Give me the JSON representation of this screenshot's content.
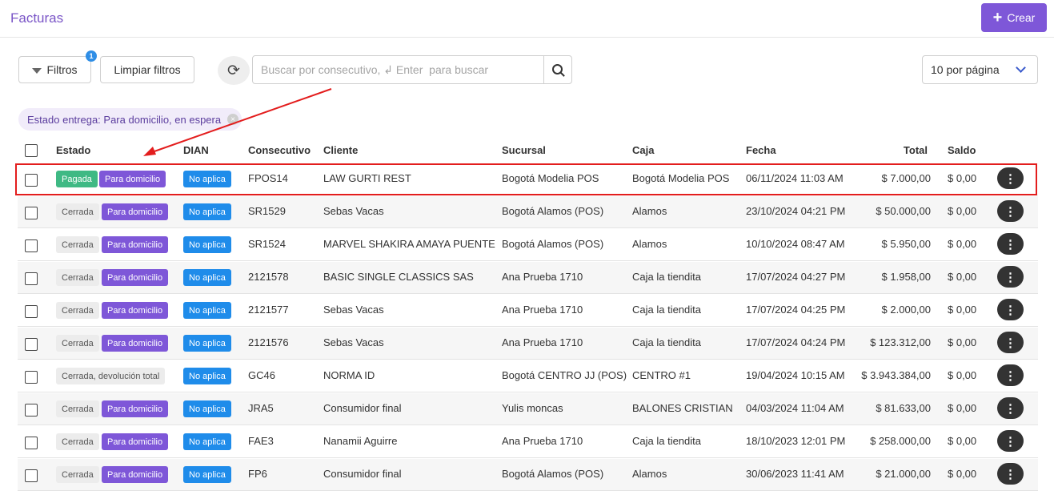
{
  "header": {
    "title": "Facturas",
    "create_label": "Crear"
  },
  "toolbar": {
    "filters_label": "Filtros",
    "filters_count": "1",
    "clear_label": "Limpiar filtros",
    "search_placeholder": "Buscar por consecutivo, ↲ Enter  para buscar",
    "per_page_label": "10 por página"
  },
  "active_filter": {
    "label": "Estado entrega: Para domicilio, en espera"
  },
  "table": {
    "columns": {
      "estado": "Estado",
      "dian": "DIAN",
      "consecutivo": "Consecutivo",
      "cliente": "Cliente",
      "sucursal": "Sucursal",
      "caja": "Caja",
      "fecha": "Fecha",
      "total": "Total",
      "saldo": "Saldo"
    },
    "rows": [
      {
        "estado": "Pagada",
        "delivery": "Para domicilio",
        "dian": "No aplica",
        "consecutivo": "FPOS14",
        "cliente": "LAW GURTI REST",
        "sucursal": "Bogotá Modelia POS",
        "caja": "Bogotá Modelia POS",
        "fecha": "06/11/2024 11:03 AM",
        "total": "$ 7.000,00",
        "saldo": "$ 0,00"
      },
      {
        "estado": "Cerrada",
        "delivery": "Para domicilio",
        "dian": "No aplica",
        "consecutivo": "SR1529",
        "cliente": "Sebas Vacas",
        "sucursal": "Bogotá Alamos (POS)",
        "caja": "Alamos",
        "fecha": "23/10/2024 04:21 PM",
        "total": "$ 50.000,00",
        "saldo": "$ 0,00"
      },
      {
        "estado": "Cerrada",
        "delivery": "Para domicilio",
        "dian": "No aplica",
        "consecutivo": "SR1524",
        "cliente": "MARVEL SHAKIRA AMAYA PUENTE",
        "sucursal": "Bogotá Alamos (POS)",
        "caja": "Alamos",
        "fecha": "10/10/2024 08:47 AM",
        "total": "$ 5.950,00",
        "saldo": "$ 0,00"
      },
      {
        "estado": "Cerrada",
        "delivery": "Para domicilio",
        "dian": "No aplica",
        "consecutivo": "2121578",
        "cliente": "BASIC SINGLE CLASSICS SAS",
        "sucursal": "Ana Prueba 1710",
        "caja": "Caja la tiendita",
        "fecha": "17/07/2024 04:27 PM",
        "total": "$ 1.958,00",
        "saldo": "$ 0,00"
      },
      {
        "estado": "Cerrada",
        "delivery": "Para domicilio",
        "dian": "No aplica",
        "consecutivo": "2121577",
        "cliente": "Sebas Vacas",
        "sucursal": "Ana Prueba 1710",
        "caja": "Caja la tiendita",
        "fecha": "17/07/2024 04:25 PM",
        "total": "$ 2.000,00",
        "saldo": "$ 0,00"
      },
      {
        "estado": "Cerrada",
        "delivery": "Para domicilio",
        "dian": "No aplica",
        "consecutivo": "2121576",
        "cliente": "Sebas Vacas",
        "sucursal": "Ana Prueba 1710",
        "caja": "Caja la tiendita",
        "fecha": "17/07/2024 04:24 PM",
        "total": "$ 123.312,00",
        "saldo": "$ 0,00"
      },
      {
        "estado": "Cerrada, devolución total",
        "delivery": "",
        "dian": "No aplica",
        "consecutivo": "GC46",
        "cliente": "NORMA ID",
        "sucursal": "Bogotá CENTRO JJ (POS)",
        "caja": "CENTRO #1",
        "fecha": "19/04/2024 10:15 AM",
        "total": "$ 3.943.384,00",
        "saldo": "$ 0,00"
      },
      {
        "estado": "Cerrada",
        "delivery": "Para domicilio",
        "dian": "No aplica",
        "consecutivo": "JRA5",
        "cliente": "Consumidor final",
        "sucursal": "Yulis moncas",
        "caja": "BALONES CRISTIAN",
        "fecha": "04/03/2024 11:04 AM",
        "total": "$ 81.633,00",
        "saldo": "$ 0,00"
      },
      {
        "estado": "Cerrada",
        "delivery": "Para domicilio",
        "dian": "No aplica",
        "consecutivo": "FAE3",
        "cliente": "Nanamii Aguirre",
        "sucursal": "Ana Prueba 1710",
        "caja": "Caja la tiendita",
        "fecha": "18/10/2023 12:01 PM",
        "total": "$ 258.000,00",
        "saldo": "$ 0,00"
      },
      {
        "estado": "Cerrada",
        "delivery": "Para domicilio",
        "dian": "No aplica",
        "consecutivo": "FP6",
        "cliente": "Consumidor final",
        "sucursal": "Bogotá Alamos (POS)",
        "caja": "Alamos",
        "fecha": "30/06/2023 11:41 AM",
        "total": "$ 21.000,00",
        "saldo": "$ 0,00"
      }
    ]
  },
  "colors": {
    "accent": "#7e57d8",
    "paid": "#3fb984",
    "dian": "#1f8cea",
    "highlight": "#e31d1d"
  }
}
